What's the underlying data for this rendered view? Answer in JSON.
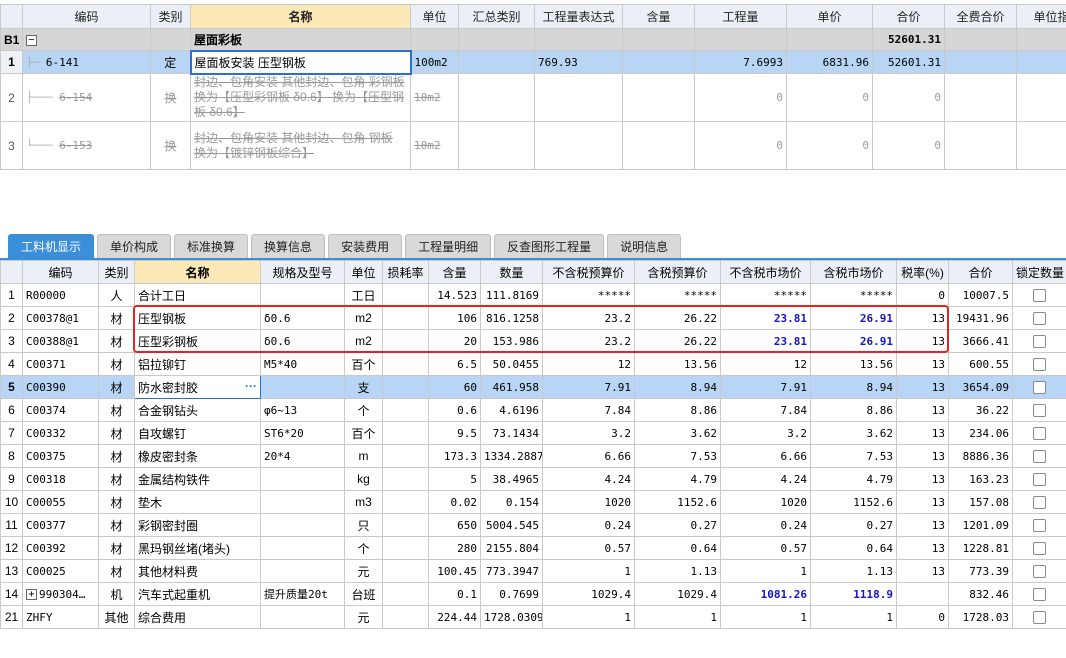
{
  "top_grid": {
    "columns": [
      "编码",
      "类别",
      "名称",
      "单位",
      "汇总类别",
      "工程量表达式",
      "含量",
      "工程量",
      "单价",
      "合价",
      "全费合价",
      "单位指"
    ],
    "group": {
      "rn": "B1",
      "toggle": "−",
      "name": "屋面彩板",
      "total": "52601.31"
    },
    "rows": [
      {
        "rn": "1",
        "code": "6-141",
        "type": "定",
        "name": "屋面板安装 压型钢板",
        "unit": "100m2",
        "summary": "",
        "expr": "769.93",
        "content": "",
        "qty": "7.6993",
        "price": "6831.96",
        "total": "52601.31",
        "full_total": "",
        "unit_idx": ""
      },
      {
        "rn": "2",
        "code": "6-154",
        "type": "换",
        "name": "封边、包角安装 其他封边、包角 彩钢板 换为【压型彩钢板 δ0.6】 换为【压型钢板 δ0.6】",
        "unit": "10m2",
        "qty": "0",
        "price": "0",
        "total": "0"
      },
      {
        "rn": "3",
        "code": "6-153",
        "type": "换",
        "name": "封边、包角安装 其他封边、包角 钢板 换为【镀锌钢板综合】",
        "unit": "10m2",
        "qty": "0",
        "price": "0",
        "total": "0"
      }
    ]
  },
  "tabs": [
    "工料机显示",
    "单价构成",
    "标准换算",
    "换算信息",
    "安装费用",
    "工程量明细",
    "反查图形工程量",
    "说明信息"
  ],
  "bottom_grid": {
    "columns": [
      "编码",
      "类别",
      "名称",
      "规格及型号",
      "单位",
      "损耗率",
      "含量",
      "数量",
      "不含税预算价",
      "含税预算价",
      "不含税市场价",
      "含税市场价",
      "税率(%)",
      "合价",
      "锁定数量"
    ],
    "rows": [
      {
        "rn": "1",
        "code": "R00000",
        "type": "人",
        "name": "合计工日",
        "spec": "",
        "unit": "工日",
        "loss": "",
        "content": "14.523",
        "qty": "111.8169",
        "p1": "*****",
        "p2": "*****",
        "p3": "*****",
        "p4": "*****",
        "tax": "0",
        "total": "10007.5"
      },
      {
        "rn": "2",
        "code": "C00378@1",
        "type": "材",
        "name": "压型钢板",
        "spec": "δ0.6",
        "unit": "m2",
        "loss": "",
        "content": "106",
        "qty": "816.1258",
        "p1": "23.2",
        "p2": "26.22",
        "p3": "23.81",
        "p4": "26.91",
        "tax": "13",
        "total": "19431.96"
      },
      {
        "rn": "3",
        "code": "C00388@1",
        "type": "材",
        "name": "压型彩钢板",
        "spec": "δ0.6",
        "unit": "m2",
        "loss": "",
        "content": "20",
        "qty": "153.986",
        "p1": "23.2",
        "p2": "26.22",
        "p3": "23.81",
        "p4": "26.91",
        "tax": "13",
        "total": "3666.41"
      },
      {
        "rn": "4",
        "code": "C00371",
        "type": "材",
        "name": "铝拉铆钉",
        "spec": "M5*40",
        "unit": "百个",
        "loss": "",
        "content": "6.5",
        "qty": "50.0455",
        "p1": "12",
        "p2": "13.56",
        "p3": "12",
        "p4": "13.56",
        "tax": "13",
        "total": "600.55"
      },
      {
        "rn": "5",
        "code": "C00390",
        "type": "材",
        "name": "防水密封胶",
        "spec": "",
        "unit": "支",
        "loss": "",
        "content": "60",
        "qty": "461.958",
        "p1": "7.91",
        "p2": "8.94",
        "p3": "7.91",
        "p4": "8.94",
        "tax": "13",
        "total": "3654.09"
      },
      {
        "rn": "6",
        "code": "C00374",
        "type": "材",
        "name": "合金钢钻头",
        "spec": "φ6~13",
        "unit": "个",
        "loss": "",
        "content": "0.6",
        "qty": "4.6196",
        "p1": "7.84",
        "p2": "8.86",
        "p3": "7.84",
        "p4": "8.86",
        "tax": "13",
        "total": "36.22"
      },
      {
        "rn": "7",
        "code": "C00332",
        "type": "材",
        "name": "自攻螺钉",
        "spec": "ST6*20",
        "unit": "百个",
        "loss": "",
        "content": "9.5",
        "qty": "73.1434",
        "p1": "3.2",
        "p2": "3.62",
        "p3": "3.2",
        "p4": "3.62",
        "tax": "13",
        "total": "234.06"
      },
      {
        "rn": "8",
        "code": "C00375",
        "type": "材",
        "name": "橡皮密封条",
        "spec": "20*4",
        "unit": "m",
        "loss": "",
        "content": "173.3",
        "qty": "1334.2887",
        "p1": "6.66",
        "p2": "7.53",
        "p3": "6.66",
        "p4": "7.53",
        "tax": "13",
        "total": "8886.36"
      },
      {
        "rn": "9",
        "code": "C00318",
        "type": "材",
        "name": "金属结构铁件",
        "spec": "",
        "unit": "kg",
        "loss": "",
        "content": "5",
        "qty": "38.4965",
        "p1": "4.24",
        "p2": "4.79",
        "p3": "4.24",
        "p4": "4.79",
        "tax": "13",
        "total": "163.23"
      },
      {
        "rn": "10",
        "code": "C00055",
        "type": "材",
        "name": "垫木",
        "spec": "",
        "unit": "m3",
        "loss": "",
        "content": "0.02",
        "qty": "0.154",
        "p1": "1020",
        "p2": "1152.6",
        "p3": "1020",
        "p4": "1152.6",
        "tax": "13",
        "total": "157.08"
      },
      {
        "rn": "11",
        "code": "C00377",
        "type": "材",
        "name": "彩钢密封圈",
        "spec": "",
        "unit": "只",
        "loss": "",
        "content": "650",
        "qty": "5004.545",
        "p1": "0.24",
        "p2": "0.27",
        "p3": "0.24",
        "p4": "0.27",
        "tax": "13",
        "total": "1201.09"
      },
      {
        "rn": "12",
        "code": "C00392",
        "type": "材",
        "name": "黑玛钢丝堵(堵头)",
        "spec": "",
        "unit": "个",
        "loss": "",
        "content": "280",
        "qty": "2155.804",
        "p1": "0.57",
        "p2": "0.64",
        "p3": "0.57",
        "p4": "0.64",
        "tax": "13",
        "total": "1228.81"
      },
      {
        "rn": "13",
        "code": "C00025",
        "type": "材",
        "name": "其他材料费",
        "spec": "",
        "unit": "元",
        "loss": "",
        "content": "100.45",
        "qty": "773.3947",
        "p1": "1",
        "p2": "1.13",
        "p3": "1",
        "p4": "1.13",
        "tax": "13",
        "total": "773.39"
      },
      {
        "rn": "14",
        "code": "990304…",
        "type": "机",
        "name": "汽车式起重机",
        "spec": "提升质量20t",
        "unit": "台班",
        "loss": "",
        "content": "0.1",
        "qty": "0.7699",
        "p1": "1029.4",
        "p2": "1029.4",
        "p3": "1081.26",
        "p4": "1118.9",
        "tax": "",
        "total": "832.46"
      },
      {
        "rn": "21",
        "code": "ZHFY",
        "type": "其他",
        "name": "综合费用",
        "spec": "",
        "unit": "元",
        "loss": "",
        "content": "224.44",
        "qty": "1728.0309",
        "p1": "1",
        "p2": "1",
        "p3": "1",
        "p4": "1",
        "tax": "0",
        "total": "1728.03"
      }
    ]
  },
  "colors": {
    "accent": "#3b8fd9",
    "highlight_row": "#b9d5f5",
    "market_price_blue": "#1414c8",
    "annotation_red": "#e52323"
  },
  "icons": {
    "collapse": "minus-icon",
    "expand": "plus-icon",
    "more": "ellipsis-icon",
    "lock": "checkbox"
  }
}
